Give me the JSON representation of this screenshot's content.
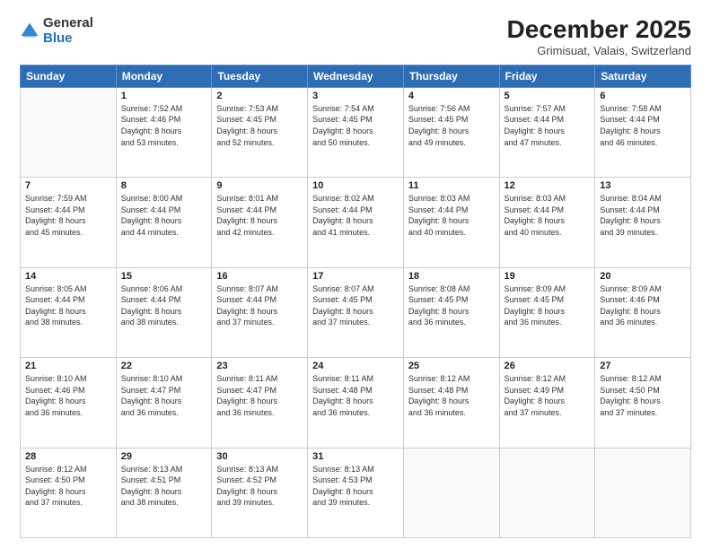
{
  "header": {
    "logo_general": "General",
    "logo_blue": "Blue",
    "month_title": "December 2025",
    "subtitle": "Grimisuat, Valais, Switzerland"
  },
  "days_of_week": [
    "Sunday",
    "Monday",
    "Tuesday",
    "Wednesday",
    "Thursday",
    "Friday",
    "Saturday"
  ],
  "weeks": [
    [
      {
        "day": "",
        "info": ""
      },
      {
        "day": "1",
        "info": "Sunrise: 7:52 AM\nSunset: 4:46 PM\nDaylight: 8 hours\nand 53 minutes."
      },
      {
        "day": "2",
        "info": "Sunrise: 7:53 AM\nSunset: 4:45 PM\nDaylight: 8 hours\nand 52 minutes."
      },
      {
        "day": "3",
        "info": "Sunrise: 7:54 AM\nSunset: 4:45 PM\nDaylight: 8 hours\nand 50 minutes."
      },
      {
        "day": "4",
        "info": "Sunrise: 7:56 AM\nSunset: 4:45 PM\nDaylight: 8 hours\nand 49 minutes."
      },
      {
        "day": "5",
        "info": "Sunrise: 7:57 AM\nSunset: 4:44 PM\nDaylight: 8 hours\nand 47 minutes."
      },
      {
        "day": "6",
        "info": "Sunrise: 7:58 AM\nSunset: 4:44 PM\nDaylight: 8 hours\nand 46 minutes."
      }
    ],
    [
      {
        "day": "7",
        "info": "Sunrise: 7:59 AM\nSunset: 4:44 PM\nDaylight: 8 hours\nand 45 minutes."
      },
      {
        "day": "8",
        "info": "Sunrise: 8:00 AM\nSunset: 4:44 PM\nDaylight: 8 hours\nand 44 minutes."
      },
      {
        "day": "9",
        "info": "Sunrise: 8:01 AM\nSunset: 4:44 PM\nDaylight: 8 hours\nand 42 minutes."
      },
      {
        "day": "10",
        "info": "Sunrise: 8:02 AM\nSunset: 4:44 PM\nDaylight: 8 hours\nand 41 minutes."
      },
      {
        "day": "11",
        "info": "Sunrise: 8:03 AM\nSunset: 4:44 PM\nDaylight: 8 hours\nand 40 minutes."
      },
      {
        "day": "12",
        "info": "Sunrise: 8:03 AM\nSunset: 4:44 PM\nDaylight: 8 hours\nand 40 minutes."
      },
      {
        "day": "13",
        "info": "Sunrise: 8:04 AM\nSunset: 4:44 PM\nDaylight: 8 hours\nand 39 minutes."
      }
    ],
    [
      {
        "day": "14",
        "info": "Sunrise: 8:05 AM\nSunset: 4:44 PM\nDaylight: 8 hours\nand 38 minutes."
      },
      {
        "day": "15",
        "info": "Sunrise: 8:06 AM\nSunset: 4:44 PM\nDaylight: 8 hours\nand 38 minutes."
      },
      {
        "day": "16",
        "info": "Sunrise: 8:07 AM\nSunset: 4:44 PM\nDaylight: 8 hours\nand 37 minutes."
      },
      {
        "day": "17",
        "info": "Sunrise: 8:07 AM\nSunset: 4:45 PM\nDaylight: 8 hours\nand 37 minutes."
      },
      {
        "day": "18",
        "info": "Sunrise: 8:08 AM\nSunset: 4:45 PM\nDaylight: 8 hours\nand 36 minutes."
      },
      {
        "day": "19",
        "info": "Sunrise: 8:09 AM\nSunset: 4:45 PM\nDaylight: 8 hours\nand 36 minutes."
      },
      {
        "day": "20",
        "info": "Sunrise: 8:09 AM\nSunset: 4:46 PM\nDaylight: 8 hours\nand 36 minutes."
      }
    ],
    [
      {
        "day": "21",
        "info": "Sunrise: 8:10 AM\nSunset: 4:46 PM\nDaylight: 8 hours\nand 36 minutes."
      },
      {
        "day": "22",
        "info": "Sunrise: 8:10 AM\nSunset: 4:47 PM\nDaylight: 8 hours\nand 36 minutes."
      },
      {
        "day": "23",
        "info": "Sunrise: 8:11 AM\nSunset: 4:47 PM\nDaylight: 8 hours\nand 36 minutes."
      },
      {
        "day": "24",
        "info": "Sunrise: 8:11 AM\nSunset: 4:48 PM\nDaylight: 8 hours\nand 36 minutes."
      },
      {
        "day": "25",
        "info": "Sunrise: 8:12 AM\nSunset: 4:48 PM\nDaylight: 8 hours\nand 36 minutes."
      },
      {
        "day": "26",
        "info": "Sunrise: 8:12 AM\nSunset: 4:49 PM\nDaylight: 8 hours\nand 37 minutes."
      },
      {
        "day": "27",
        "info": "Sunrise: 8:12 AM\nSunset: 4:50 PM\nDaylight: 8 hours\nand 37 minutes."
      }
    ],
    [
      {
        "day": "28",
        "info": "Sunrise: 8:12 AM\nSunset: 4:50 PM\nDaylight: 8 hours\nand 37 minutes."
      },
      {
        "day": "29",
        "info": "Sunrise: 8:13 AM\nSunset: 4:51 PM\nDaylight: 8 hours\nand 38 minutes."
      },
      {
        "day": "30",
        "info": "Sunrise: 8:13 AM\nSunset: 4:52 PM\nDaylight: 8 hours\nand 39 minutes."
      },
      {
        "day": "31",
        "info": "Sunrise: 8:13 AM\nSunset: 4:53 PM\nDaylight: 8 hours\nand 39 minutes."
      },
      {
        "day": "",
        "info": ""
      },
      {
        "day": "",
        "info": ""
      },
      {
        "day": "",
        "info": ""
      }
    ]
  ]
}
